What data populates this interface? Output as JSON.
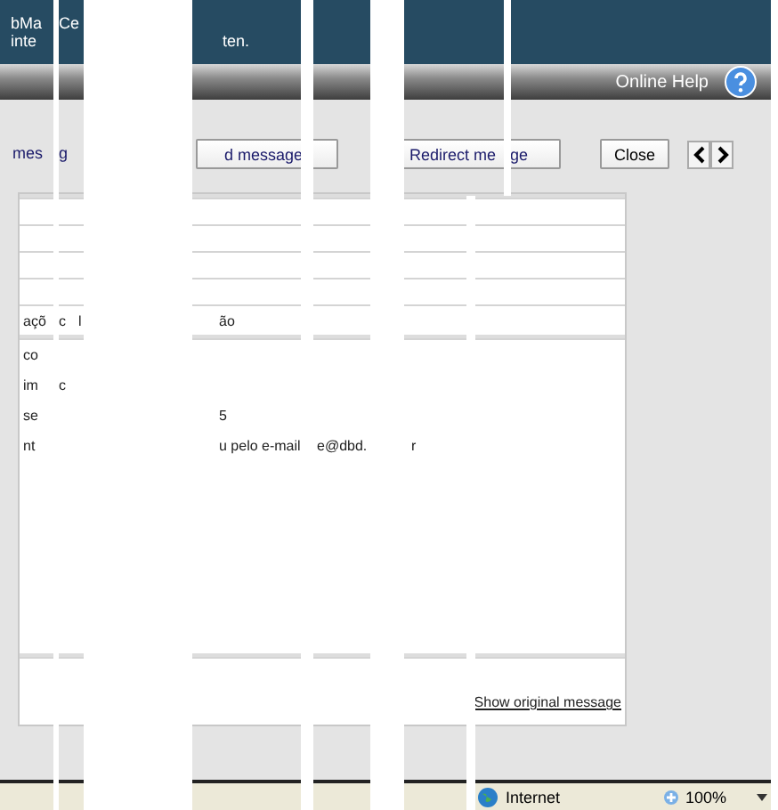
{
  "header": {
    "line_1": [
      "bMa",
      "Ce"
    ],
    "line_2": [
      "inte",
      "ten."
    ]
  },
  "toolbar": {
    "help_link": "Online Help"
  },
  "buttons": [
    {
      "kind": "bare",
      "parts": [
        "mes"
      ]
    },
    {
      "kind": "bare",
      "parts": [
        "g"
      ]
    },
    {
      "kind": "button",
      "parts": [
        "d message"
      ]
    },
    {
      "kind": "button",
      "parts": [
        "Redirect me",
        "ge"
      ]
    },
    {
      "kind": "button",
      "parts": [
        "Close"
      ]
    }
  ],
  "message_rows": [
    {
      "column_1": "açõ",
      "column_2": "c",
      "column_3": "l",
      "column_4": "ão"
    },
    {
      "column_1": "co"
    },
    {
      "column_1": "im",
      "column_2": "c"
    },
    {
      "column_1": "se",
      "column_4": "5"
    },
    {
      "column_1": "nt",
      "column_4": "u pelo e-mail",
      "column_5": "e@dbd.",
      "column_6": "r"
    }
  ],
  "footer_link": "Show original message",
  "status_bar": {
    "zone": "Internet",
    "zoom": "100%"
  }
}
